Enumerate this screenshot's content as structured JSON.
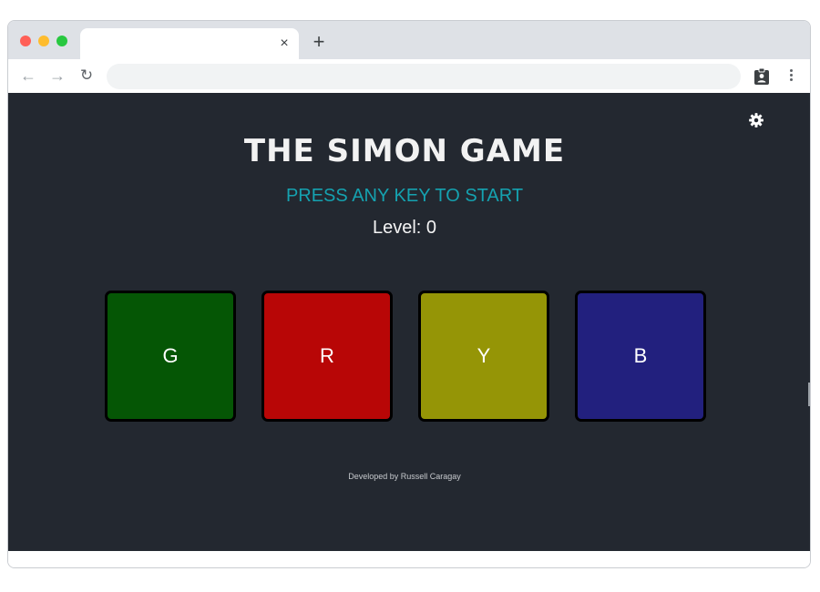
{
  "browser": {
    "tab_close_glyph": "×",
    "new_tab_glyph": "+",
    "back_glyph": "←",
    "forward_glyph": "→",
    "reload_glyph": "↻",
    "address": ""
  },
  "game": {
    "title": "THE SIMON GAME",
    "prompt": "PRESS ANY KEY TO START",
    "level_text": "Level: 0",
    "pads": [
      {
        "label": "G",
        "color": "#055605"
      },
      {
        "label": "R",
        "color": "#b80606"
      },
      {
        "label": "Y",
        "color": "#959506"
      },
      {
        "label": "B",
        "color": "#22207e"
      }
    ],
    "credit": "Developed by Russell Caragay",
    "settings_icon": "gear-icon"
  },
  "colors": {
    "page_background": "#232830",
    "accent": "#15a2b0"
  }
}
